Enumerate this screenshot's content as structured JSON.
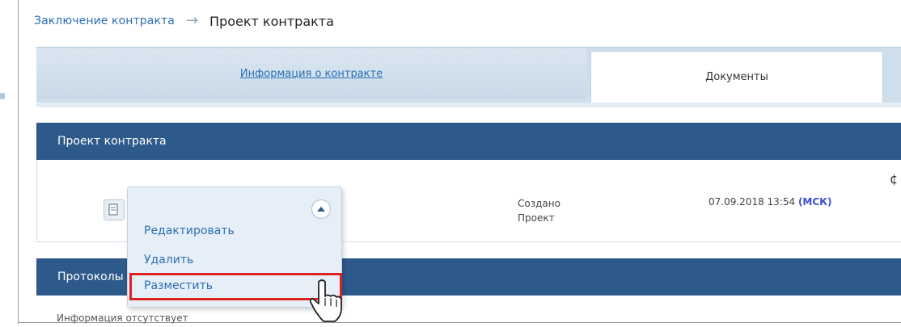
{
  "breadcrumb": {
    "parent_label": "Заключение контракта",
    "separator": "→",
    "current_label": "Проект контракта"
  },
  "tabs": [
    {
      "label": "Информация о контракте",
      "active": false
    },
    {
      "label": "Документы",
      "active": true
    }
  ],
  "project_section": {
    "title": "Проект контракта",
    "row": {
      "icon": "document-icon",
      "status_line1": "Создано",
      "status_line2": "Проект",
      "date": "07.09.2018 13:54",
      "timezone": "(МСК)"
    }
  },
  "protocols_section": {
    "title": "Протоколы",
    "empty_text": "Информация отсутствует"
  },
  "action_menu": {
    "items": [
      "Редактировать",
      "Удалить",
      "Разместить"
    ],
    "highlighted_item": "Разместить",
    "collapse_icon": "chevron-up-icon",
    "highlight_color": "#e12020"
  },
  "colors": {
    "link": "#2a6fb3",
    "section_header": "#2d5a8b",
    "timezone": "#3a4fd1"
  }
}
